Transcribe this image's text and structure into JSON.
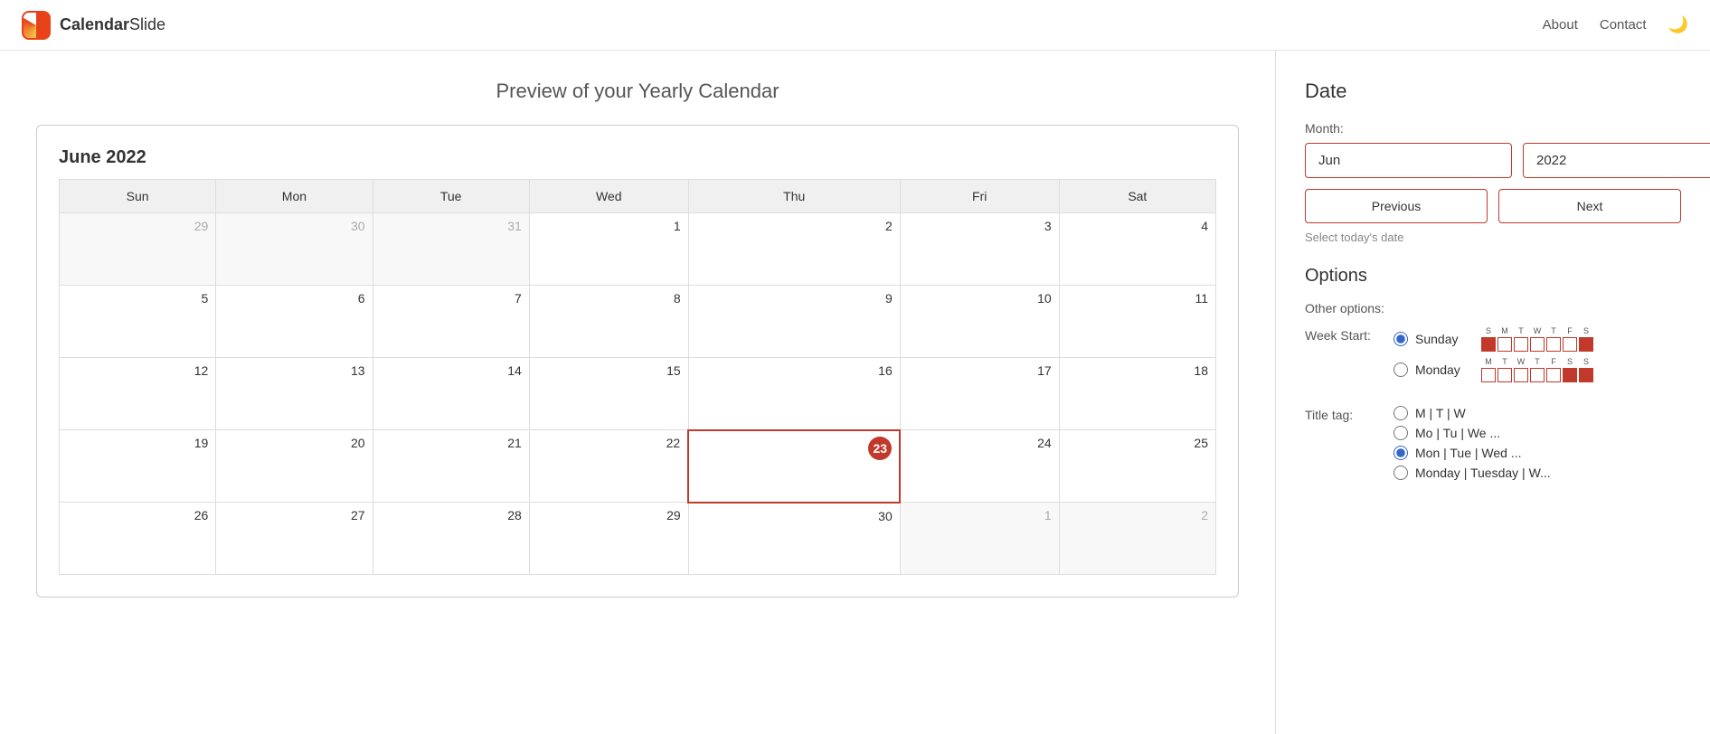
{
  "navbar": {
    "brand": "CalendarSlide",
    "brand_bold": "Calendar",
    "brand_light": "Slide",
    "links": [
      "About",
      "Contact"
    ],
    "moon_icon": "🌙"
  },
  "preview": {
    "title": "Preview of your Yearly Calendar"
  },
  "calendar": {
    "month_title": "June 2022",
    "days_of_week": [
      "Sun",
      "Mon",
      "Tue",
      "Wed",
      "Thu",
      "Fri",
      "Sat"
    ],
    "weeks": [
      [
        {
          "day": 29,
          "type": "other"
        },
        {
          "day": 30,
          "type": "other"
        },
        {
          "day": 31,
          "type": "other"
        },
        {
          "day": 1,
          "type": "current"
        },
        {
          "day": 2,
          "type": "current"
        },
        {
          "day": 3,
          "type": "current"
        },
        {
          "day": 4,
          "type": "current"
        }
      ],
      [
        {
          "day": 5,
          "type": "current"
        },
        {
          "day": 6,
          "type": "current"
        },
        {
          "day": 7,
          "type": "current"
        },
        {
          "day": 8,
          "type": "current"
        },
        {
          "day": 9,
          "type": "current"
        },
        {
          "day": 10,
          "type": "current"
        },
        {
          "day": 11,
          "type": "current"
        }
      ],
      [
        {
          "day": 12,
          "type": "current"
        },
        {
          "day": 13,
          "type": "current"
        },
        {
          "day": 14,
          "type": "current"
        },
        {
          "day": 15,
          "type": "current"
        },
        {
          "day": 16,
          "type": "current"
        },
        {
          "day": 17,
          "type": "current"
        },
        {
          "day": 18,
          "type": "current"
        }
      ],
      [
        {
          "day": 19,
          "type": "current"
        },
        {
          "day": 20,
          "type": "current"
        },
        {
          "day": 21,
          "type": "current"
        },
        {
          "day": 22,
          "type": "current"
        },
        {
          "day": 23,
          "type": "today"
        },
        {
          "day": 24,
          "type": "current"
        },
        {
          "day": 25,
          "type": "current"
        }
      ],
      [
        {
          "day": 26,
          "type": "current"
        },
        {
          "day": 27,
          "type": "current"
        },
        {
          "day": 28,
          "type": "current"
        },
        {
          "day": 29,
          "type": "current"
        },
        {
          "day": 30,
          "type": "current"
        },
        {
          "day": 1,
          "type": "other"
        },
        {
          "day": 2,
          "type": "other"
        }
      ]
    ]
  },
  "date_section": {
    "title": "Date",
    "month_label": "Month:",
    "month_value": "Jun",
    "year_value": "2022",
    "prev_button": "Previous",
    "next_button": "Next",
    "hint": "Select today's date"
  },
  "options_section": {
    "title": "Options",
    "other_options_label": "Other options:",
    "week_start_label": "Week Start:",
    "sunday_label": "Sunday",
    "monday_label": "Monday",
    "sunday_days": [
      "S",
      "M",
      "T",
      "W",
      "T",
      "F",
      "S"
    ],
    "sunday_filled": [
      0,
      6
    ],
    "monday_days": [
      "M",
      "T",
      "W",
      "T",
      "F",
      "S",
      "S"
    ],
    "monday_filled": [
      5,
      6
    ],
    "title_tag_label": "Title tag:",
    "title_tag_options": [
      {
        "value": "M|T|W",
        "label": "M | T | W"
      },
      {
        "value": "Mo|Tu|We...",
        "label": "Mo | Tu | We ..."
      },
      {
        "value": "Mon|Tue|Wed...",
        "label": "Mon | Tue | Wed ...",
        "selected": true
      },
      {
        "value": "Monday|Tuesday|W...",
        "label": "Monday | Tuesday | W..."
      }
    ]
  }
}
